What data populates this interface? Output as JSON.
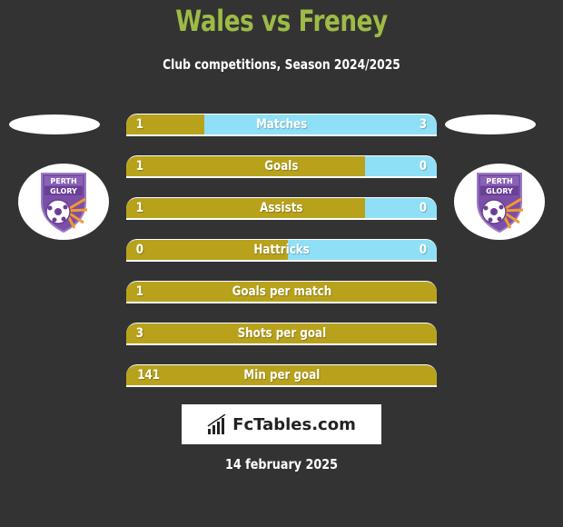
{
  "header": {
    "title": "Wales vs Freney",
    "subtitle": "Club competitions, Season 2024/2025"
  },
  "teams": {
    "left": {
      "name": "Wales",
      "logo": "perth-glory-crest-icon",
      "logo_text_1": "PERTH",
      "logo_text_2": "GLORY"
    },
    "right": {
      "name": "Freney",
      "logo": "perth-glory-crest-icon",
      "logo_text_1": "PERTH",
      "logo_text_2": "GLORY"
    }
  },
  "colors": {
    "background": "#333333",
    "title": "#9dbb46",
    "left_bar": "#b8a21c",
    "right_bar": "#8fe0f7"
  },
  "stats": [
    {
      "label": "Matches",
      "left": "1",
      "right": "3",
      "left_share": 0.25
    },
    {
      "label": "Goals",
      "left": "1",
      "right": "0",
      "left_share": 0.77
    },
    {
      "label": "Assists",
      "left": "1",
      "right": "0",
      "left_share": 0.77
    },
    {
      "label": "Hattricks",
      "left": "0",
      "right": "0",
      "left_share": 0.52
    },
    {
      "label": "Goals per match",
      "left": "1",
      "right": "",
      "left_share": 1.0
    },
    {
      "label": "Shots per goal",
      "left": "3",
      "right": "",
      "left_share": 1.0
    },
    {
      "label": "Min per goal",
      "left": "141",
      "right": "",
      "left_share": 1.0
    }
  ],
  "footer": {
    "brand": "FcTables.com",
    "date": "14 february 2025"
  }
}
